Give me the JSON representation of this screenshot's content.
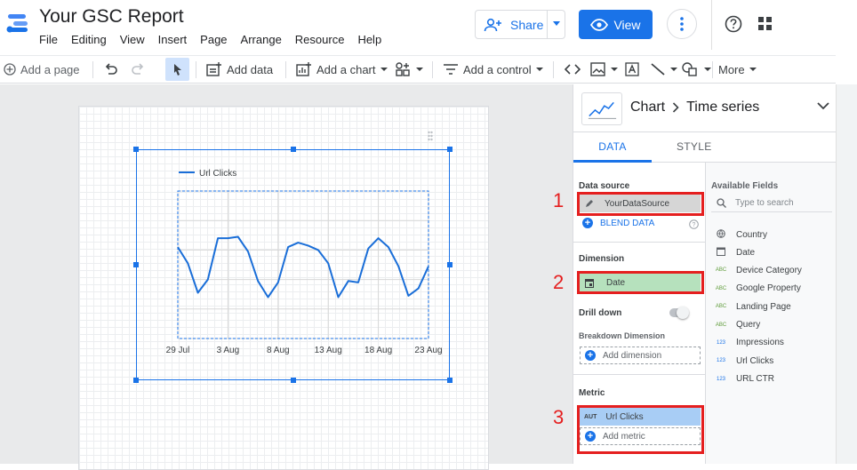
{
  "header": {
    "title": "Your GSC Report",
    "menus": [
      "File",
      "Editing",
      "View",
      "Insert",
      "Page",
      "Arrange",
      "Resource",
      "Help"
    ],
    "share_label": "Share",
    "view_label": "View"
  },
  "toolbar": {
    "add_page": "Add a page",
    "add_data": "Add data",
    "add_chart": "Add a chart",
    "add_control": "Add a control",
    "more": "More"
  },
  "chart": {
    "legend": "Url Clicks",
    "color": "#1a6ed8"
  },
  "chart_data": {
    "type": "line",
    "x": [
      "29 Jul",
      "30 Jul",
      "31 Jul",
      "1 Aug",
      "2 Aug",
      "3 Aug",
      "4 Aug",
      "5 Aug",
      "6 Aug",
      "7 Aug",
      "8 Aug",
      "9 Aug",
      "10 Aug",
      "11 Aug",
      "12 Aug",
      "13 Aug",
      "14 Aug",
      "15 Aug",
      "16 Aug",
      "17 Aug",
      "18 Aug",
      "19 Aug",
      "20 Aug",
      "21 Aug",
      "22 Aug",
      "23 Aug"
    ],
    "xtick_labels": [
      "29 Jul",
      "3 Aug",
      "8 Aug",
      "13 Aug",
      "18 Aug",
      "23 Aug"
    ],
    "series": [
      {
        "name": "Url Clicks",
        "values": [
          62,
          51,
          31,
          40,
          68,
          68,
          69,
          59,
          39,
          28,
          38,
          62,
          65,
          63,
          60,
          51,
          28,
          39,
          38,
          61,
          68,
          62,
          49,
          29,
          34,
          49
        ]
      }
    ],
    "ylim": [
      0,
      100
    ],
    "grid": true,
    "legend": "top-left"
  },
  "panel": {
    "chart_label": "Chart",
    "chart_type": "Time series",
    "tab_data": "DATA",
    "tab_style": "STYLE",
    "data_source_label": "Data source",
    "data_source_value": "YourDataSource",
    "blend_data": "BLEND DATA",
    "dimension_label": "Dimension",
    "dimension_value": "Date",
    "drill_down": "Drill down",
    "breakdown_label": "Breakdown Dimension",
    "add_dimension": "Add dimension",
    "metric_label": "Metric",
    "metric_type": "AUT",
    "metric_value": "Url Clicks",
    "add_metric": "Add metric",
    "available_fields": "Available Fields",
    "search_placeholder": "Type to search",
    "fields": [
      {
        "type": "geo",
        "name": "Country"
      },
      {
        "type": "date",
        "name": "Date"
      },
      {
        "type": "ABC",
        "name": "Device Category"
      },
      {
        "type": "ABC",
        "name": "Google Property"
      },
      {
        "type": "ABC",
        "name": "Landing Page"
      },
      {
        "type": "ABC",
        "name": "Query"
      },
      {
        "type": "123",
        "name": "Impressions"
      },
      {
        "type": "123",
        "name": "Url Clicks"
      },
      {
        "type": "123",
        "name": "URL CTR"
      }
    ]
  },
  "annotations": [
    "1",
    "2",
    "3"
  ]
}
